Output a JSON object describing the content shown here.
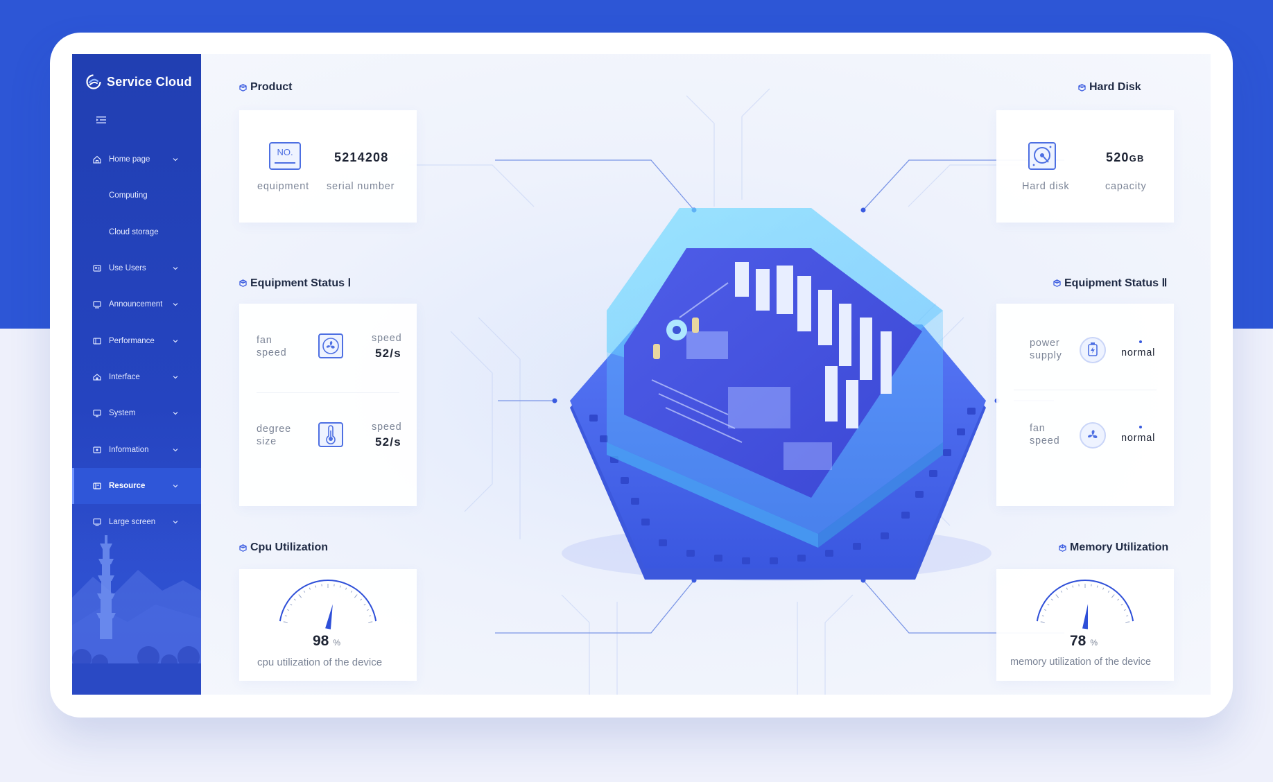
{
  "brand": {
    "name": "Service Cloud"
  },
  "sidebar": {
    "items": [
      {
        "label": "Home page",
        "icon": "home-icon",
        "has_chevron": true,
        "sub": false
      },
      {
        "label": "Computing",
        "icon": "",
        "has_chevron": false,
        "sub": true
      },
      {
        "label": "Cloud storage",
        "icon": "",
        "has_chevron": false,
        "sub": true
      },
      {
        "label": "Use Users",
        "icon": "users-icon",
        "has_chevron": true,
        "sub": false
      },
      {
        "label": "Announcement",
        "icon": "announcement-icon",
        "has_chevron": true,
        "sub": false
      },
      {
        "label": "Performance",
        "icon": "performance-icon",
        "has_chevron": true,
        "sub": false
      },
      {
        "label": "Interface",
        "icon": "interface-icon",
        "has_chevron": true,
        "sub": false
      },
      {
        "label": "System",
        "icon": "system-icon",
        "has_chevron": true,
        "sub": false
      },
      {
        "label": "Information",
        "icon": "information-icon",
        "has_chevron": true,
        "sub": false
      },
      {
        "label": "Resource",
        "icon": "resource-icon",
        "has_chevron": true,
        "sub": false,
        "active": true
      },
      {
        "label": "Large screen",
        "icon": "large-screen-icon",
        "has_chevron": true,
        "sub": false
      }
    ]
  },
  "product": {
    "title": "Product",
    "icon_text": "NO.",
    "serial": "5214208",
    "equipment_label": "equipment",
    "serial_label": "serial number"
  },
  "hard_disk": {
    "title": "Hard Disk",
    "capacity_value": "520",
    "capacity_unit": "GB",
    "disk_label": "Hard disk",
    "capacity_label": "capacity"
  },
  "status1": {
    "title": "Equipment Status Ⅰ",
    "rows": [
      {
        "label_line1": "fan",
        "label_line2": "speed",
        "icon": "fan-icon",
        "metric": "speed",
        "value": "52/s"
      },
      {
        "label_line1": "degree",
        "label_line2": "size",
        "icon": "thermometer-icon",
        "metric": "speed",
        "value": "52/s"
      }
    ]
  },
  "status2": {
    "title": "Equipment Status Ⅱ",
    "rows": [
      {
        "label_line1": "power",
        "label_line2": "supply",
        "icon": "power-supply-icon",
        "value": "normal"
      },
      {
        "label_line1": "fan",
        "label_line2": "speed",
        "icon": "fan-icon",
        "value": "normal"
      }
    ]
  },
  "cpu": {
    "title": "Cpu Utilization",
    "value": 98,
    "value_text": "98",
    "unit": "%",
    "caption": "cpu utilization of the device"
  },
  "memory": {
    "title": "Memory Utilization",
    "value": 78,
    "value_text": "78",
    "unit": "%",
    "caption": "memory utilization of the device"
  },
  "colors": {
    "brand_blue": "#2d56d6",
    "sidebar": "#213fb2",
    "active_item": "#2f56d8",
    "accent": "#3659dd",
    "chip": "#4f6ff0",
    "glass": "#66d6ff"
  }
}
